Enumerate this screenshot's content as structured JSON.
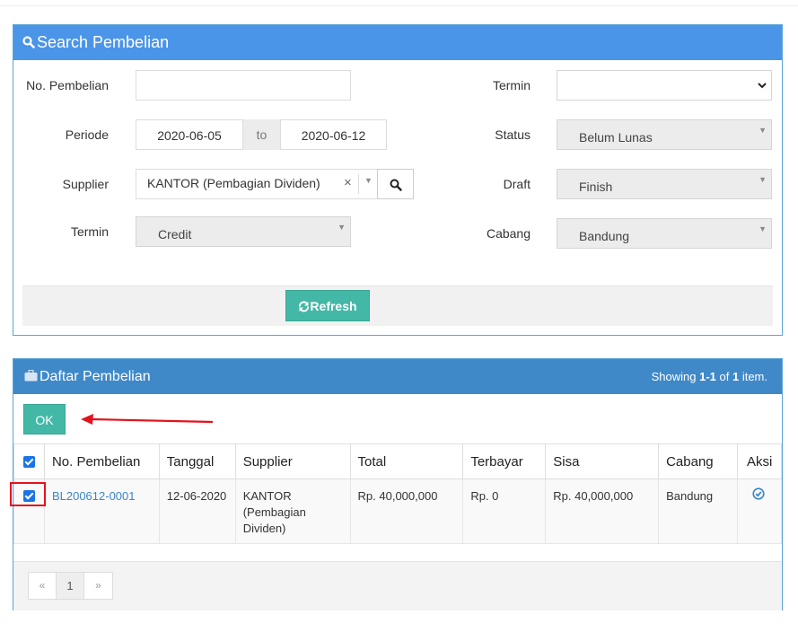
{
  "search_panel": {
    "title": "Search Pembelian",
    "fields": {
      "no_pembelian_label": "No. Pembelian",
      "no_pembelian_value": "",
      "periode_label": "Periode",
      "periode_from": "2020-06-05",
      "periode_to_sep": "to",
      "periode_to": "2020-06-12",
      "supplier_label": "Supplier",
      "supplier_value": "KANTOR (Pembagian Dividen)",
      "termin_left_label": "Termin",
      "termin_left_value": "Credit",
      "termin_right_label": "Termin",
      "termin_right_value": "",
      "status_label": "Status",
      "status_value": "Belum Lunas",
      "draft_label": "Draft",
      "draft_value": "Finish",
      "cabang_label": "Cabang",
      "cabang_value": "Bandung"
    },
    "refresh_label": "Refresh"
  },
  "list_panel": {
    "title": "Daftar Pembelian",
    "showing_prefix": "Showing ",
    "showing_range": "1-1",
    "showing_of": " of ",
    "showing_total": "1",
    "showing_suffix": " item.",
    "ok_label": "OK",
    "columns": [
      "No. Pembelian",
      "Tanggal",
      "Supplier",
      "Total",
      "Terbayar",
      "Sisa",
      "Cabang",
      "Aksi"
    ],
    "rows": [
      {
        "no": "BL200612-0001",
        "tanggal": "12-06-2020",
        "supplier": "KANTOR (Pembagian Dividen)",
        "total": "Rp. 40,000,000",
        "terbayar": "Rp. 0",
        "sisa": "Rp. 40,000,000",
        "cabang": "Bandung"
      }
    ],
    "pager": {
      "prev": "«",
      "current": "1",
      "next": "»"
    }
  },
  "colors": {
    "search_header": "#4b95e8",
    "list_header": "#3f89c8",
    "button_teal": "#44b8a6",
    "annotation_red": "#e4121c",
    "link": "#3a86c8"
  },
  "icons": {
    "search_title": "search-icon",
    "list_title": "briefcase-icon",
    "refresh": "refresh-icon",
    "supplier_search": "search-icon",
    "aksi": "check-circle-icon"
  }
}
